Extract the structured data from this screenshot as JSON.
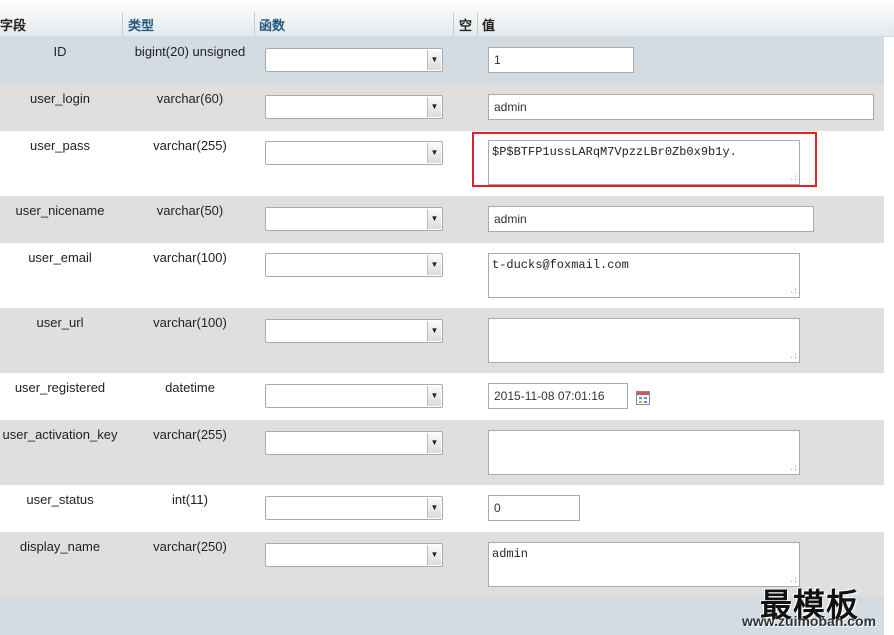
{
  "header": {
    "field": "字段",
    "type": "类型",
    "function": "函数",
    "null": "空",
    "value": "值"
  },
  "rows": [
    {
      "field": "ID",
      "type": "bigint(20) unsigned",
      "function": "",
      "value": "1"
    },
    {
      "field": "user_login",
      "type": "varchar(60)",
      "function": "",
      "value": "admin"
    },
    {
      "field": "user_pass",
      "type": "varchar(255)",
      "function": "",
      "value": "$P$BTFP1ussLARqM7VpzzLBr0Zb0x9b1y."
    },
    {
      "field": "user_nicename",
      "type": "varchar(50)",
      "function": "",
      "value": "admin"
    },
    {
      "field": "user_email",
      "type": "varchar(100)",
      "function": "",
      "value": "t-ducks@foxmail.com"
    },
    {
      "field": "user_url",
      "type": "varchar(100)",
      "function": "",
      "value": ""
    },
    {
      "field": "user_registered",
      "type": "datetime",
      "function": "",
      "value": "2015-11-08 07:01:16"
    },
    {
      "field": "user_activation_key",
      "type": "varchar(255)",
      "function": "",
      "value": ""
    },
    {
      "field": "user_status",
      "type": "int(11)",
      "function": "",
      "value": "0"
    },
    {
      "field": "display_name",
      "type": "varchar(250)",
      "function": "",
      "value": "admin"
    }
  ],
  "icons": {
    "dropdown": "chevron-down-icon",
    "calendar": "calendar-icon",
    "resize": "resize-grip-icon"
  },
  "colors": {
    "header_link": "#235a81",
    "row_blue": "#d3dce3",
    "row_grey": "#dfdfdf",
    "highlight": "#e2222a"
  },
  "watermark": {
    "text": "最模板",
    "url": "www.zuimoban.com"
  }
}
